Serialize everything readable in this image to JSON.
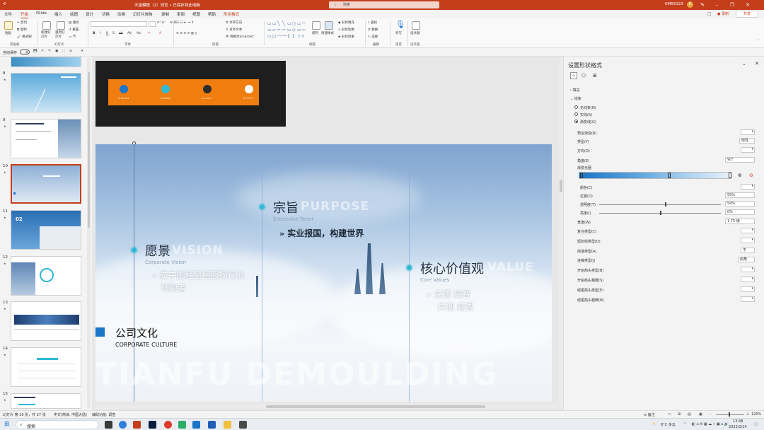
{
  "titlebar": {
    "doc_title": "天宙模橙（2）浏览 • 已保存到此电脑",
    "search": "搜索",
    "user": "KM56323",
    "user_initial": "K"
  },
  "menu": {
    "tabs": [
      "文件",
      "开始",
      "iSlide",
      "插入",
      "绘图",
      "设计",
      "切换",
      "动画",
      "幻灯片放映",
      "录制",
      "审阅",
      "视图",
      "帮助"
    ],
    "context_tab": "形状格式",
    "record": "录制",
    "share": "共享"
  },
  "ribbon": {
    "paste": "粘贴",
    "cut": "剪切",
    "copy": "复制",
    "format_painter": "格式刷",
    "new_slide": "新建幻灯片",
    "reuse_slide": "重用幻灯片",
    "layout": "版式",
    "reset": "重置",
    "section": "节",
    "text_direction": "文字方向",
    "align_text": "对齐文本",
    "convert_smartart": "转换为SmartArt",
    "arrange": "排列",
    "quick_styles": "快速样式",
    "shape_fill": "形状填充",
    "shape_outline": "形状轮廓",
    "shape_effects": "形状效果",
    "find": "查找",
    "replace": "替换",
    "select": "选择",
    "dictate": "听写",
    "designer": "设计器",
    "groups": {
      "clipboard": "剪贴板",
      "slides": "幻灯片",
      "font": "字体",
      "paragraph": "段落",
      "drawing": "绘图",
      "editing": "编辑",
      "voice": "语音",
      "designer": "设计器"
    }
  },
  "qat": {
    "autosave": "自动保存",
    "autosave_state": "关"
  },
  "thumbnails": [
    {
      "num": "8",
      "star": "★"
    },
    {
      "num": "9",
      "star": "★"
    },
    {
      "num": "10",
      "star": "★",
      "selected": true
    },
    {
      "num": "11",
      "star": "★"
    },
    {
      "num": "12",
      "star": "★"
    },
    {
      "num": "13",
      "star": "★"
    },
    {
      "num": "14",
      "star": "★"
    },
    {
      "num": "15",
      "star": "★"
    }
  ],
  "prev_slide": {
    "colors": [
      {
        "hex": "#1B75C8",
        "label": "# 1B75C8"
      },
      {
        "hex": "#2FB9D6",
        "label": "# 2FB9D6"
      },
      {
        "hex": "#2C2C2C",
        "label": "# 2c2c2c"
      },
      {
        "hex": "#FFFFFF",
        "label": "# FFFFFF"
      }
    ]
  },
  "slide": {
    "vision_cn": "愿景",
    "vision_en": "VISION",
    "vision_sub": "Corporate Vision",
    "vision_body_1": "做中国轻型屈服模行业",
    "vision_body_2": "领跑者",
    "purpose_cn": "宗旨",
    "purpose_en": "PURPOSE",
    "purpose_sub": "Enterprise Tenet",
    "purpose_body": "实业报国，构建世界",
    "value_cn": "核心价值观",
    "value_en": "VALUE",
    "value_sub": "Core Values",
    "value_body_1": "立德 启智",
    "value_body_2": "共创 感恩",
    "culture_title": "公司文化",
    "culture_sub": "CORPORATE CULTURE",
    "watermark": "TIANFU DEMOULDING",
    "chevron": "»"
  },
  "pane": {
    "title": "设置形状格式",
    "fill": "填充",
    "line": "线条",
    "no_line": "无线条(N)",
    "solid_line": "实线(S)",
    "gradient_line": "渐变线(G)",
    "preset_gradient": "预设渐变(R)",
    "type": "类型(Y)",
    "type_value": "线性",
    "direction": "方向(D)",
    "angle": "角度(E)",
    "angle_value": "90°",
    "gradient_stops": "渐变光圈",
    "color": "颜色(C)",
    "position": "位置(O)",
    "position_value": "59%",
    "position_level": 0.59,
    "transparency": "透明度(T)",
    "transparency_value": "54%",
    "transparency_level": 0.54,
    "brightness": "亮度(I)",
    "brightness_value": "0%",
    "brightness_level": 0.5,
    "width": "宽度(W)",
    "width_value": "1.75 磅",
    "compound": "复合类型(C)",
    "dash": "短划线类型(D)",
    "cap": "线端类型(A)",
    "cap_value": "平",
    "join": "连接类型(J)",
    "join_value": "斜角",
    "begin_arrow_type": "开始箭头类型(B)",
    "begin_arrow_size": "开始箭头粗细(S)",
    "end_arrow_type": "结尾箭头类型(E)",
    "end_arrow_size": "结尾箭头粗细(N)"
  },
  "status": {
    "slide_info": "幻灯片 第 10 张，共 27 张",
    "language": "中文(简体, 中国大陆)",
    "accessibility": "辅助功能: 调查",
    "notes": "备注",
    "zoom": "120%"
  },
  "taskbar": {
    "search": "搜索",
    "weather": "6°C 多云",
    "time": "13:48",
    "date": "2023/2/14"
  }
}
